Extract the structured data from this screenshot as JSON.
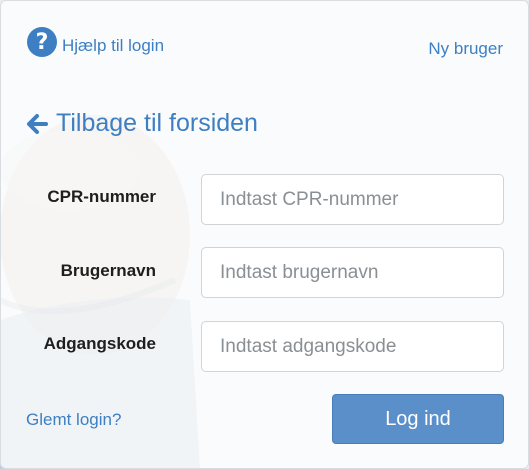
{
  "header": {
    "help_label": "Hjælp til login",
    "new_user_label": "Ny bruger"
  },
  "back": {
    "label": "Tilbage til forsiden"
  },
  "form": {
    "fields": [
      {
        "label": "CPR-nummer",
        "placeholder": "Indtast CPR-nummer",
        "value": ""
      },
      {
        "label": "Brugernavn",
        "placeholder": "Indtast brugernavn",
        "value": ""
      },
      {
        "label": "Adgangskode",
        "placeholder": "Indtast adgangskode",
        "value": ""
      }
    ],
    "forgot_label": "Glemt login?",
    "submit_label": "Log ind"
  },
  "colors": {
    "link": "#3d7fc2",
    "button": "#5b8fc9"
  }
}
